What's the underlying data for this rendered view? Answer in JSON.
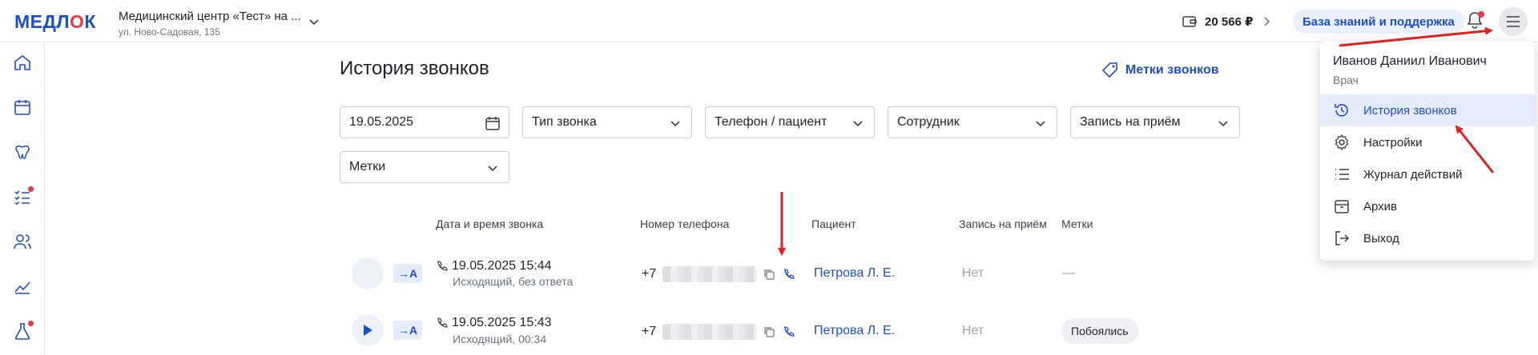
{
  "header": {
    "logo_main": "МЕДЛ",
    "logo_accent": "О",
    "logo_end": "К",
    "clinic_name": "Медицинский центр «Тест» на ...",
    "clinic_address": "ул. Ново-Садовая, 135",
    "balance": "20 566 ₽",
    "kb_button": "База знаний и поддержка"
  },
  "sidebar": {
    "items": [
      "home-icon",
      "calendar-icon",
      "tooth-icon",
      "checklist-icon",
      "people-icon",
      "chart-icon",
      "flask-icon"
    ]
  },
  "page": {
    "title": "История звонков",
    "tags_link": "Метки звонков"
  },
  "filters": {
    "date": "19.05.2025",
    "call_type": "Тип звонка",
    "phone_patient": "Телефон / пациент",
    "employee": "Сотрудник",
    "appointment": "Запись на приём",
    "tags": "Метки"
  },
  "table": {
    "headers": {
      "datetime": "Дата и время звонка",
      "phone": "Номер телефона",
      "patient": "Пациент",
      "appointment": "Запись на приём",
      "tags": "Метки"
    },
    "rows": [
      {
        "direction": "→A",
        "datetime": "19.05.2025 15:44",
        "status": "Исходящий, без ответа",
        "phone_prefix": "+7",
        "patient": "Петрова Л. Е.",
        "appointment": "Нет",
        "tag": "—"
      },
      {
        "direction": "→A",
        "datetime": "19.05.2025 15:43",
        "status": "Исходящий, 00:34",
        "phone_prefix": "+7",
        "patient": "Петрова Л. Е.",
        "appointment": "Нет",
        "tag": "Побоялись"
      }
    ]
  },
  "user_menu": {
    "name": "Иванов Даниил Иванович",
    "role": "Врач",
    "items": [
      {
        "label": "История звонков",
        "icon": "history-icon",
        "active": true
      },
      {
        "label": "Настройки",
        "icon": "gear-icon",
        "active": false
      },
      {
        "label": "Журнал действий",
        "icon": "list-icon",
        "active": false
      },
      {
        "label": "Архив",
        "icon": "archive-icon",
        "active": false
      },
      {
        "label": "Выход",
        "icon": "logout-icon",
        "active": false
      }
    ]
  },
  "colors": {
    "brand_blue": "#1d4fc4",
    "brand_red": "#e63946",
    "annotation_red": "#e02020"
  }
}
